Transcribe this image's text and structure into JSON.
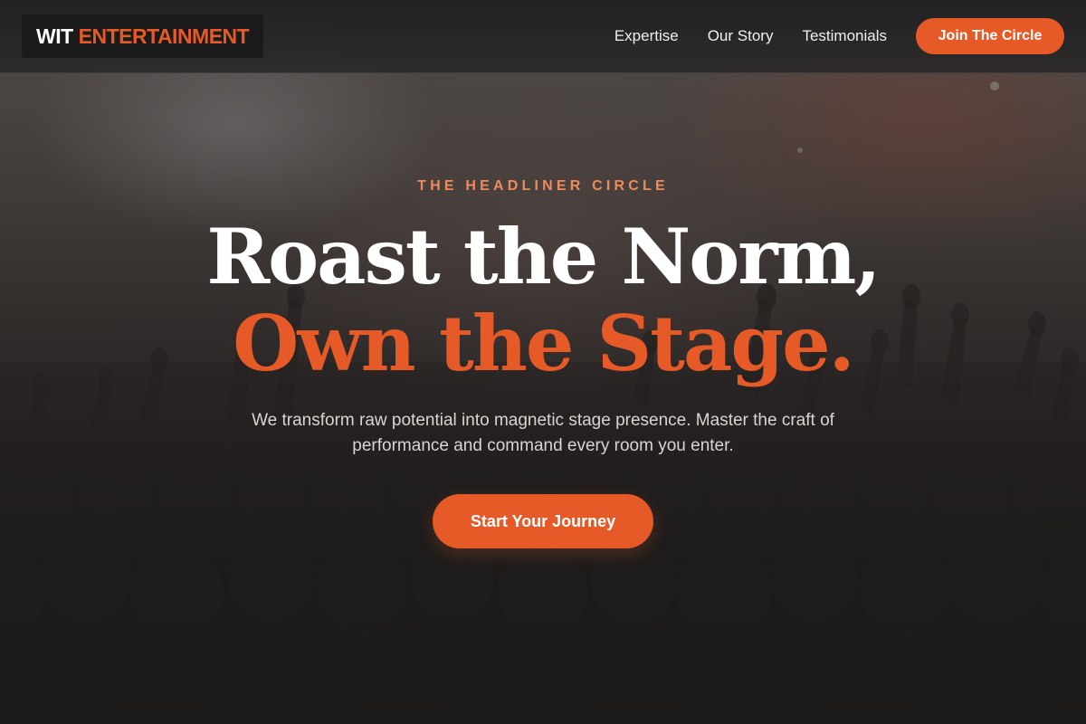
{
  "brand": {
    "name_primary": "WIT",
    "name_accent": "ENTERTAINMENT"
  },
  "nav": {
    "items": [
      {
        "label": "Expertise"
      },
      {
        "label": "Our Story"
      },
      {
        "label": "Testimonials"
      }
    ],
    "cta_label": "Join The Circle"
  },
  "hero": {
    "eyebrow": "THE HEADLINER CIRCLE",
    "headline_line1": "Roast the Norm,",
    "headline_line2": "Own the Stage.",
    "subtitle": "We transform raw potential into magnetic stage presence. Master the craft of performance and command every room you enter.",
    "cta_label": "Start Your Journey",
    "background": "concert-crowd-photo"
  },
  "colors": {
    "accent": "#e55a26",
    "eyebrow": "#ef8a5a",
    "background": "#1c1b1b",
    "header_bg": "#262525",
    "logo_bg": "#1a1a1a"
  }
}
